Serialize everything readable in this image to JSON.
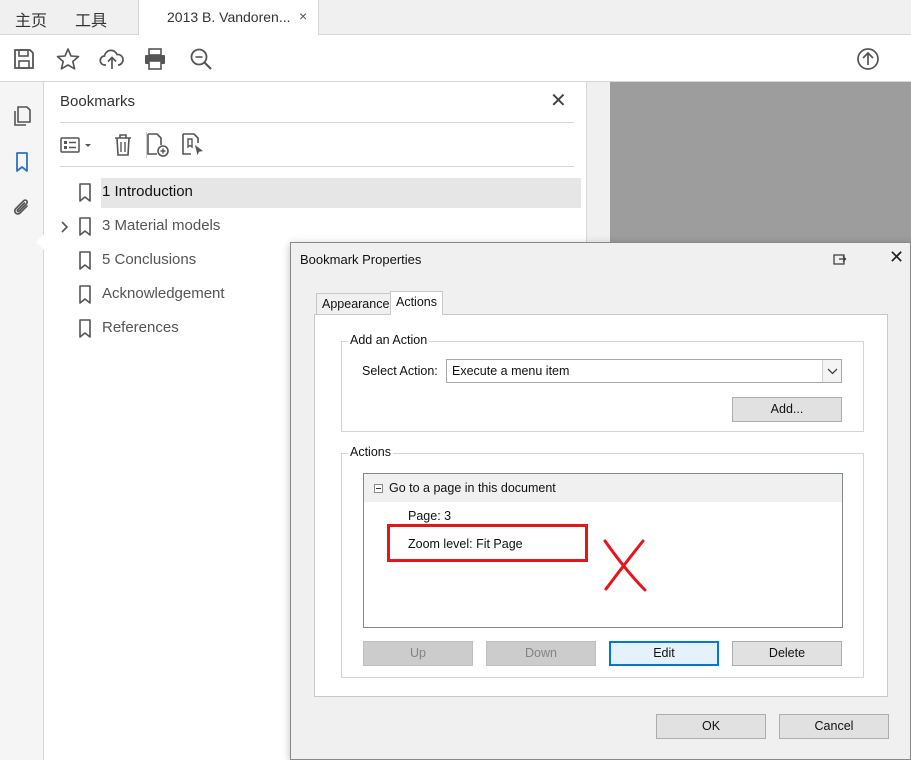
{
  "tabs": {
    "home": "主页",
    "tools": "工具",
    "document": "2013 B. Vandoren...",
    "close_glyph": "×"
  },
  "toolbar": {
    "icons": [
      "save-icon",
      "star-icon",
      "cloud-upload-icon",
      "print-icon",
      "zoom-search-icon",
      "page-up-icon"
    ]
  },
  "rail": {
    "icons": [
      "pages-icon",
      "bookmark-icon",
      "attachment-icon"
    ]
  },
  "bookmarks_panel": {
    "title": "Bookmarks",
    "close_glyph": "✕",
    "items": [
      {
        "label": "1 Introduction",
        "selected": true,
        "expandable": false
      },
      {
        "label": "3 Material models",
        "selected": false,
        "expandable": true
      },
      {
        "label": "5 Conclusions",
        "selected": false,
        "expandable": false
      },
      {
        "label": "Acknowledgement",
        "selected": false,
        "expandable": false
      },
      {
        "label": "References",
        "selected": false,
        "expandable": false
      }
    ]
  },
  "dialog": {
    "title": "Bookmark Properties",
    "close_glyph": "✕",
    "tabs": [
      "Appearance",
      "Actions"
    ],
    "active_tab": "Actions",
    "add_action": {
      "group_title": "Add an Action",
      "select_label": "Select Action:",
      "select_value": "Execute a menu item",
      "add_button": "Add..."
    },
    "actions": {
      "group_title": "Actions",
      "action_title": "Go to a page in this document",
      "details": [
        "Page: 3",
        "Zoom level: Fit Page"
      ],
      "buttons": {
        "up": "Up",
        "down": "Down",
        "edit": "Edit",
        "delete": "Delete"
      }
    },
    "ok": "OK",
    "cancel": "Cancel"
  },
  "colors": {
    "accent": "#0078d7",
    "annotation_red": "#e8141c",
    "bookmark_blue": "#2b73c6"
  }
}
